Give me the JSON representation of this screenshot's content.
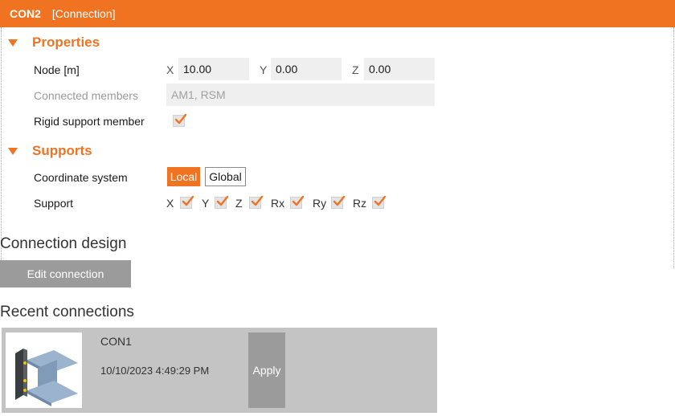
{
  "title": {
    "name": "CON2",
    "type": "[Connection]"
  },
  "properties": {
    "heading": "Properties",
    "node": {
      "label": "Node [m]",
      "x_label": "X",
      "x_value": "10.00",
      "y_label": "Y",
      "y_value": "0.00",
      "z_label": "Z",
      "z_value": "0.00"
    },
    "connected_members": {
      "label": "Connected members",
      "value": "AM1, RSM"
    },
    "rigid_support": {
      "label": "Rigid support member",
      "checked": true
    }
  },
  "supports": {
    "heading": "Supports",
    "coordinate_system": {
      "label": "Coordinate system",
      "local": "Local",
      "global": "Global",
      "selected": "Local"
    },
    "support": {
      "label": "Support",
      "items": [
        {
          "label": "X",
          "checked": true
        },
        {
          "label": "Y",
          "checked": true
        },
        {
          "label": "Z",
          "checked": true
        },
        {
          "label": "Rx",
          "checked": true
        },
        {
          "label": "Ry",
          "checked": true
        },
        {
          "label": "Rz",
          "checked": true
        }
      ]
    }
  },
  "connection_design": {
    "heading": "Connection design",
    "edit_button": "Edit connection"
  },
  "recent": {
    "heading": "Recent connections",
    "items": [
      {
        "name": "CON1",
        "date": "10/10/2023 4:49:29 PM",
        "apply": "Apply",
        "thumbnail_icon": "steel-joint-3d-icon"
      }
    ]
  },
  "colors": {
    "accent": "#f07322",
    "button_gray": "#9b9b9b",
    "card_gray": "#c4c4c4",
    "field_bg": "#efefef"
  }
}
